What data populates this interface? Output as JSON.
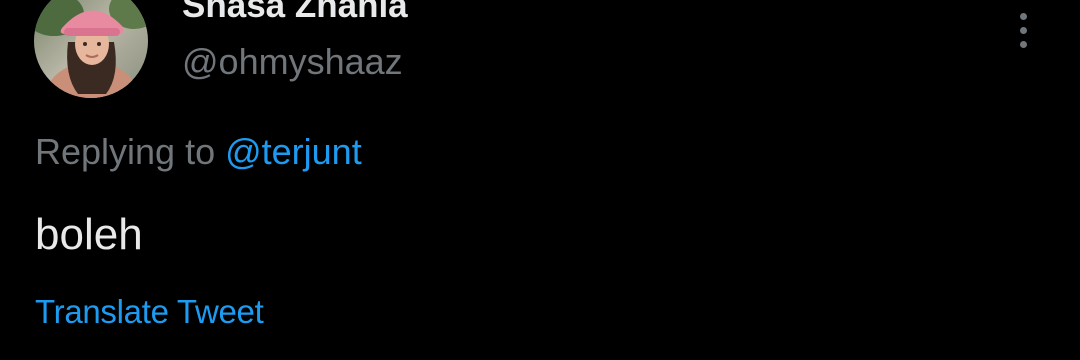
{
  "user": {
    "display_name": "Shasa Zhania",
    "handle": "@ohmyshaaz"
  },
  "reply": {
    "prefix": "Replying to ",
    "mention": "@terjunt"
  },
  "tweet": {
    "text": "boleh"
  },
  "actions": {
    "translate_label": "Translate Tweet",
    "more_icon": "more-vertical-icon"
  },
  "colors": {
    "background": "#000000",
    "primary_text": "#e7e9ea",
    "secondary_text": "#71767b",
    "accent": "#1d9bf0"
  }
}
